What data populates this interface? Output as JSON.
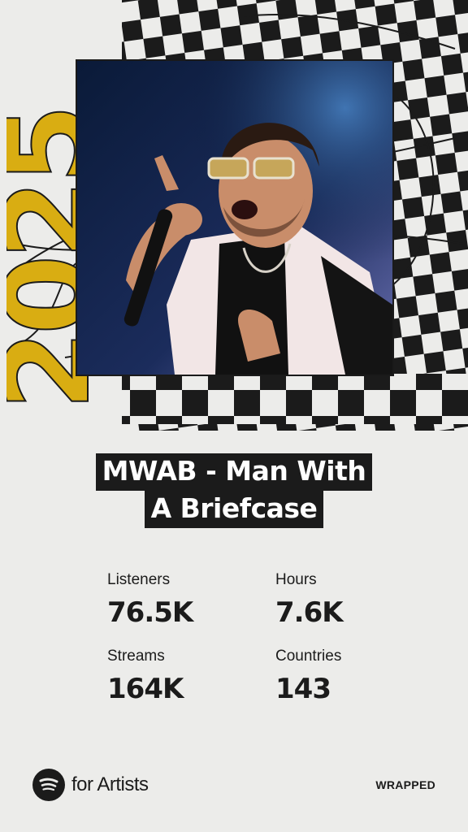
{
  "card": {
    "year": "2025",
    "artist_name_lines": [
      "MWAB - Man With",
      "A Briefcase"
    ],
    "stats": [
      {
        "label": "Listeners",
        "value": "76.5K"
      },
      {
        "label": "Hours",
        "value": "7.6K"
      },
      {
        "label": "Streams",
        "value": "164K"
      },
      {
        "label": "Countries",
        "value": "143"
      }
    ],
    "photo_icon": "artist-photo",
    "accent_color": "#d9ad12"
  },
  "footer": {
    "brand_icon": "spotify-icon",
    "brand_text": "for Artists",
    "badge": "WRAPPED"
  }
}
